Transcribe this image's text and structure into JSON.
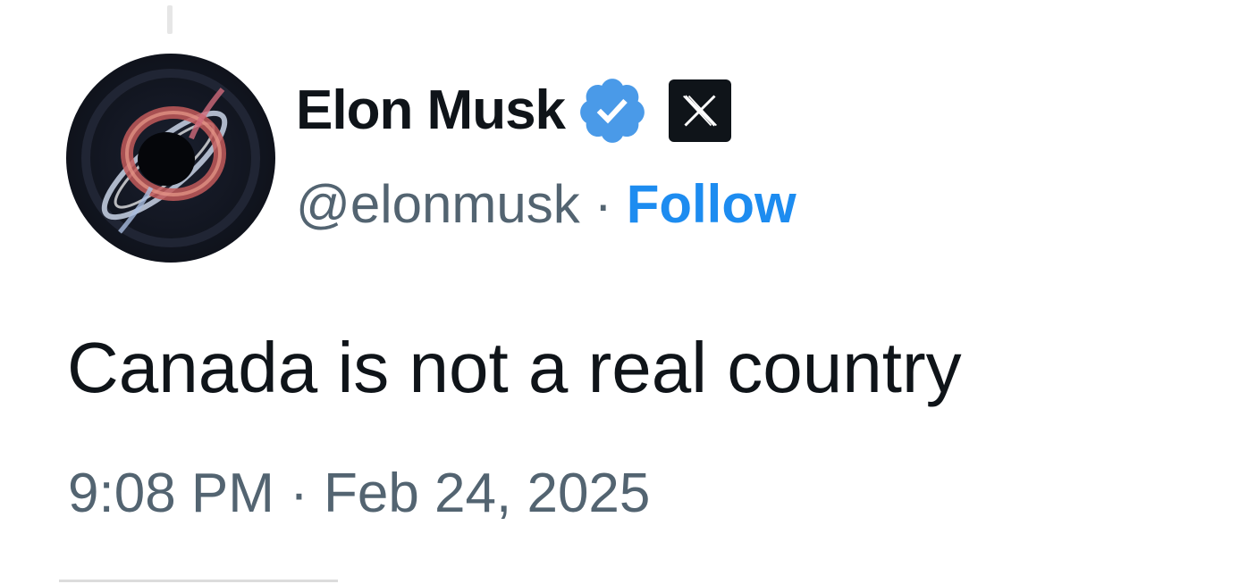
{
  "author": {
    "name": "Elon Musk",
    "handle": "@elonmusk",
    "separator": "·",
    "follow_label": "Follow",
    "avatar_icon": "black-hole-avatar-icon",
    "verified_icon": "verified-badge-icon",
    "affiliation_icon": "x-logo-icon"
  },
  "tweet": {
    "text": "Canada is not a real country",
    "timestamp": "9:08 PM · Feb 24, 2025"
  },
  "colors": {
    "text": "#0f1419",
    "secondary": "#536471",
    "follow": "#1d8cf0",
    "verified": "#4a9ae8",
    "x_badge_bg": "#0f1419"
  }
}
